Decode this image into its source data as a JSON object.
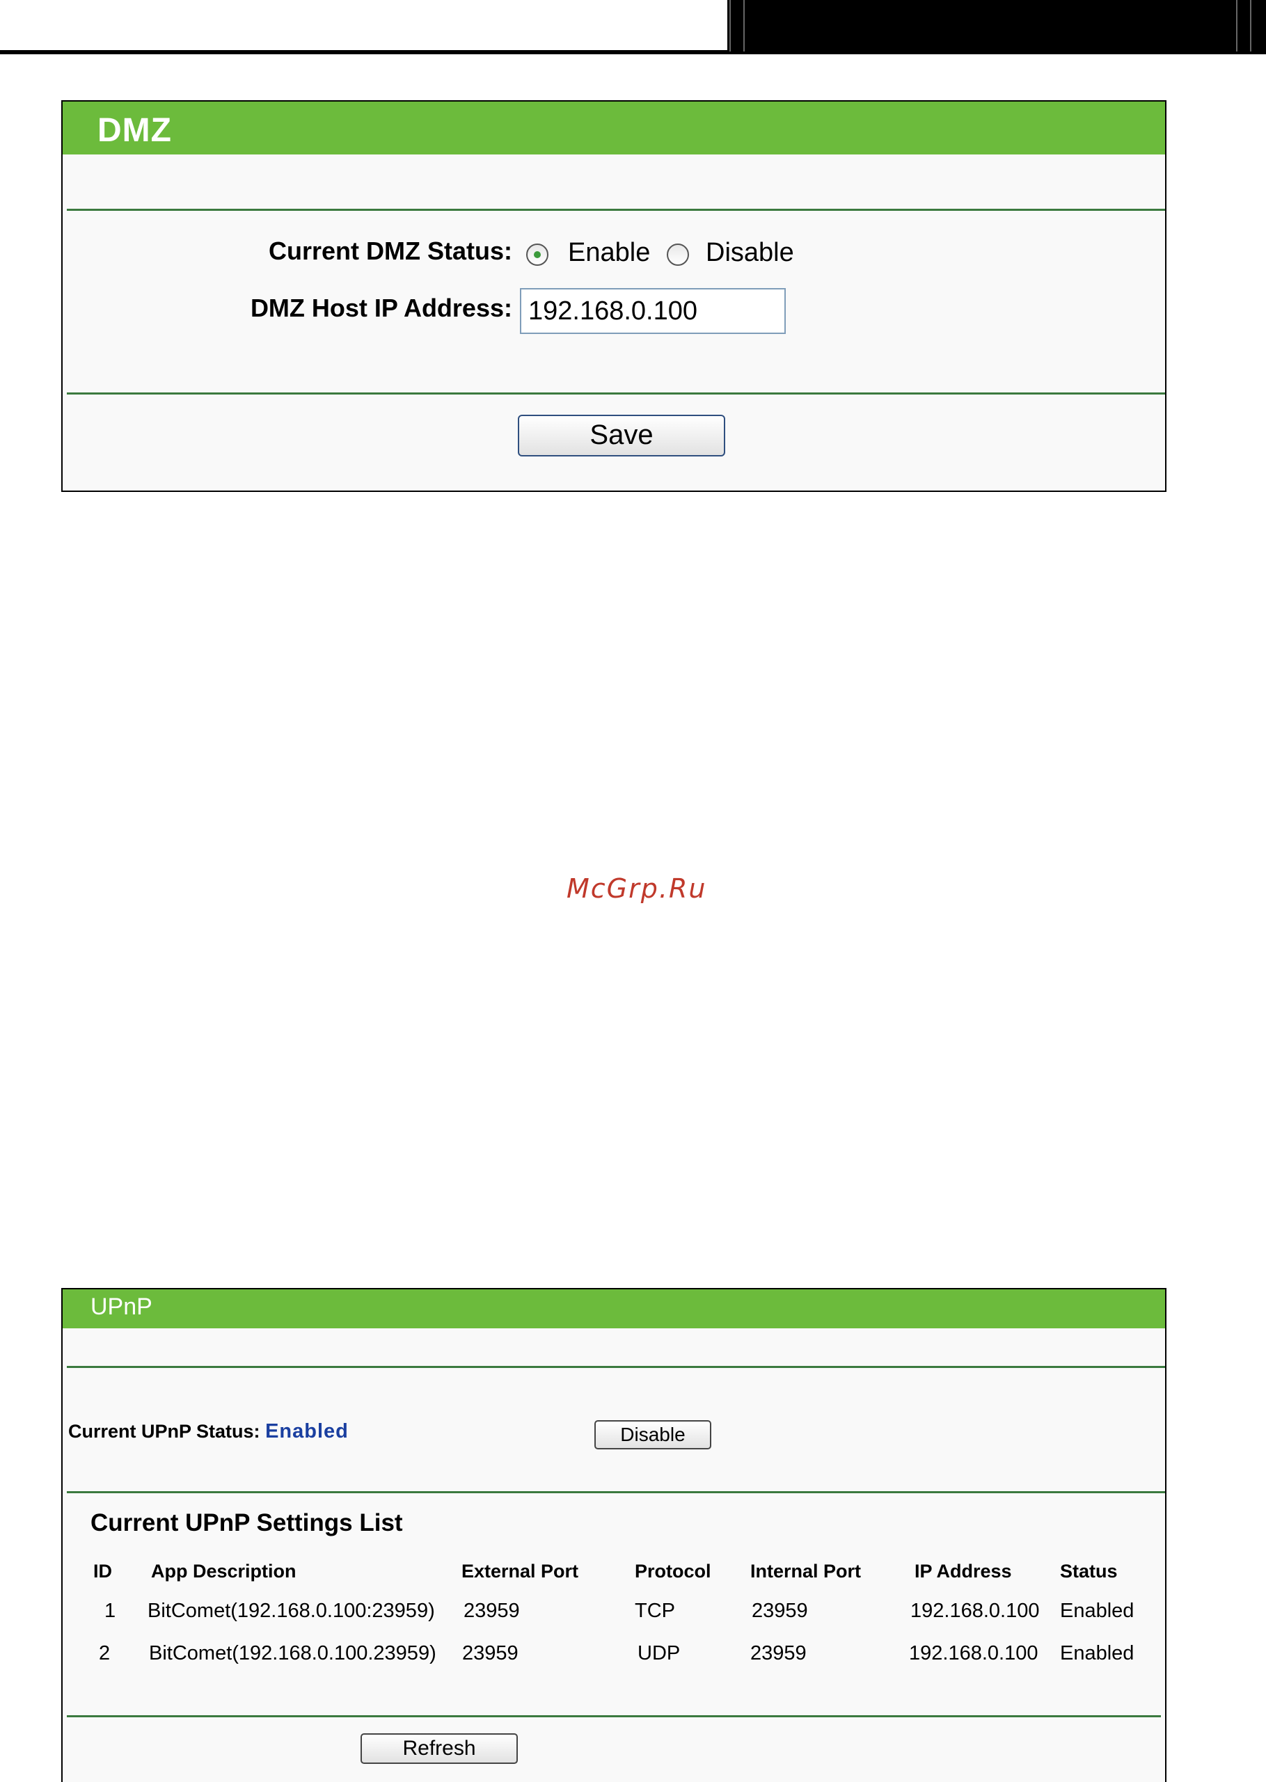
{
  "dmz": {
    "title": "DMZ",
    "status_label": "Current DMZ Status:",
    "enable_label": "Enable",
    "disable_label": "Disable",
    "selected": "Enable",
    "host_ip_label": "DMZ Host IP Address:",
    "host_ip_value": "192.168.0.100",
    "save_label": "Save"
  },
  "watermark": "McGrp.Ru",
  "upnp": {
    "title": "UPnP",
    "status_label": "Current UPnP Status:",
    "status_value": "Enabled",
    "disable_label": "Disable",
    "list_title": "Current UPnP Settings List",
    "columns": [
      "ID",
      "App Description",
      "External Port",
      "Protocol",
      "Internal Port",
      "IP Address",
      "Status"
    ],
    "rows": [
      [
        "1",
        "BitComet(192.168.0.100:23959)",
        "23959",
        "TCP",
        "23959",
        "192.168.0.100",
        "Enabled"
      ],
      [
        "2",
        "BitComet(192.168.0.100.23959)",
        "23959",
        "UDP",
        "23959",
        "192.168.0.100",
        "Enabled"
      ]
    ],
    "refresh_label": "Refresh"
  },
  "colors": {
    "title_bar": "#6cbb3c",
    "rule": "#3b7a3f",
    "status_value": "#1a3fa0",
    "watermark": "#c0392b"
  }
}
